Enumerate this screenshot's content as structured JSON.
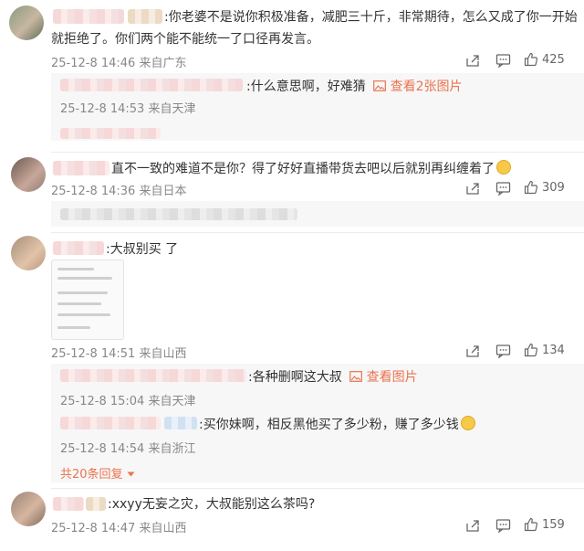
{
  "comments": [
    {
      "text": ":你老婆不是说你积极准备，减肥三十斤，非常期待，怎么又成了你一开始",
      "text2": "就拒绝了。你们两个能不能统一了口径再发言。",
      "time": "25-12-8 14:46",
      "location": "来自广东",
      "likes": "425",
      "replies": [
        {
          "text": ":什么意思啊，好难猜",
          "pic_link": "查看2张图片",
          "time": "25-12-8 14:53",
          "location": "来自天津"
        }
      ]
    },
    {
      "text": "直不一致的难道不是你？得了好好直播带货去吧以后就别再纠缠着了",
      "time": "25-12-8 14:36",
      "location": "来自日本",
      "likes": "309"
    },
    {
      "text": ":大叔别买",
      "text_tail": "了",
      "time": "25-12-8 14:51",
      "location": "来自山西",
      "likes": "134",
      "replies": [
        {
          "text": ":各种删啊这大叔",
          "pic_link": "查看图片",
          "time": "25-12-8 15:04",
          "location": "来自天津"
        },
        {
          "text": ":买你妹啊，相反黑他买了多少粉，赚了多少钱",
          "time": "25-12-8 14:54",
          "location": "来自浙江"
        }
      ],
      "more_replies": "共20条回复"
    },
    {
      "text": ":xxyy无妄之灾，大叔能别这么茶吗?",
      "time": "25-12-8 14:47",
      "location": "来自山西",
      "likes": "159"
    }
  ],
  "icons": [
    "share-icon",
    "comment-icon",
    "like-icon",
    "picture-icon",
    "emoji-icon",
    "chevron-down-icon"
  ],
  "colors": {
    "accent": "#eb7350",
    "meta": "#888888",
    "reply_bg": "#f7f7f7"
  }
}
